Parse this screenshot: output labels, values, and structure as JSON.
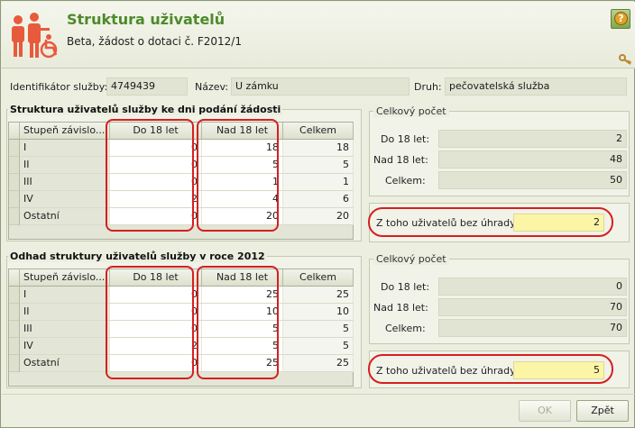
{
  "header": {
    "title": "Struktura uživatelů",
    "subtitle": "Beta, žádost o dotaci č. F2012/1",
    "help_symbol": "?",
    "logo_icon": "people-wheelchair-icon",
    "key_icon": "key-icon"
  },
  "info": {
    "id_label": "Identifikátor služby:",
    "id_value": "4749439",
    "name_label": "Název:",
    "name_value": "U zámku",
    "type_label": "Druh:",
    "type_value": "pečovatelská služba"
  },
  "grid_headers": [
    "Stupeň závislo...",
    "Do 18 let",
    "Nad 18 let",
    "Celkem"
  ],
  "section1": {
    "title": "Struktura uživatelů služby ke dni podání žádosti",
    "rows": [
      [
        "I",
        "0",
        "18",
        "18"
      ],
      [
        "II",
        "0",
        "5",
        "5"
      ],
      [
        "III",
        "0",
        "1",
        "1"
      ],
      [
        "IV",
        "2",
        "4",
        "6"
      ],
      [
        "Ostatní",
        "0",
        "20",
        "20"
      ]
    ],
    "summary": {
      "legend": "Celkový počet",
      "under18_label": "Do 18 let:",
      "under18_value": "2",
      "over18_label": "Nad 18 let:",
      "over18_value": "48",
      "total_label": "Celkem:",
      "total_value": "50",
      "free_label": "Z toho uživatelů bez úhrady:",
      "free_value": "2"
    }
  },
  "section2": {
    "title": "Odhad struktury uživatelů služby v roce 2012",
    "rows": [
      [
        "I",
        "0",
        "25",
        "25"
      ],
      [
        "II",
        "0",
        "10",
        "10"
      ],
      [
        "III",
        "0",
        "5",
        "5"
      ],
      [
        "IV",
        "2",
        "5",
        "5"
      ],
      [
        "Ostatní",
        "0",
        "25",
        "25"
      ]
    ],
    "summary": {
      "legend": "Celkový počet",
      "under18_label": "Do 18 let:",
      "under18_value": "0",
      "over18_label": "Nad 18 let:",
      "over18_value": "70",
      "total_label": "Celkem:",
      "total_value": "70",
      "free_label": "Z toho uživatelů bez úhrady:",
      "free_value": "5"
    }
  },
  "buttons": {
    "ok": "OK",
    "back": "Zpět"
  }
}
